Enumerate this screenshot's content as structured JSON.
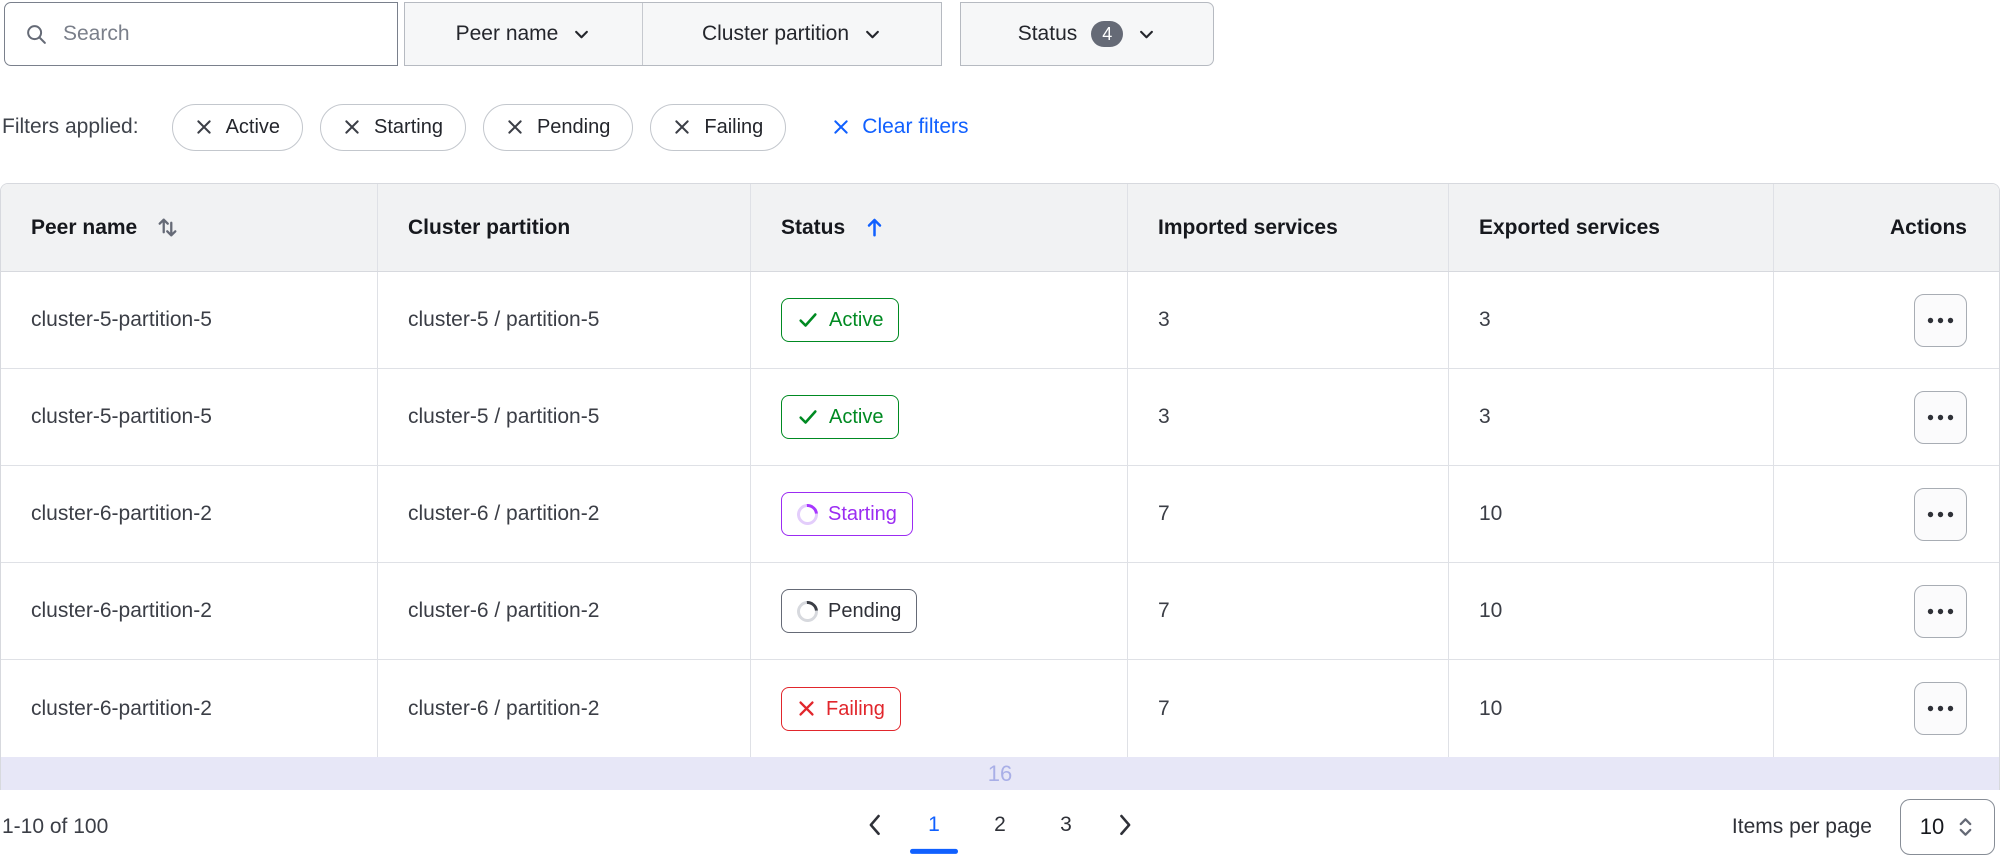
{
  "toolbar": {
    "search_placeholder": "Search",
    "dropdowns": [
      {
        "label": "Peer name"
      },
      {
        "label": "Cluster partition"
      },
      {
        "label": "Status",
        "count": "4"
      }
    ]
  },
  "filters_applied": {
    "label": "Filters applied:",
    "pills": [
      "Active",
      "Starting",
      "Pending",
      "Failing"
    ],
    "clear_label": "Clear filters"
  },
  "table": {
    "columns": [
      {
        "label": "Peer name",
        "sort": "both"
      },
      {
        "label": "Cluster partition",
        "sort": "none"
      },
      {
        "label": "Status",
        "sort": "asc"
      },
      {
        "label": "Imported services",
        "sort": "none"
      },
      {
        "label": "Exported services",
        "sort": "none"
      },
      {
        "label": "Actions",
        "sort": "none"
      }
    ],
    "rows": [
      {
        "peer_name": "cluster-5-partition-5",
        "cluster_partition": "cluster-5 / partition-5",
        "status": "Active",
        "imported": "3",
        "exported": "3"
      },
      {
        "peer_name": "cluster-5-partition-5",
        "cluster_partition": "cluster-5 / partition-5",
        "status": "Active",
        "imported": "3",
        "exported": "3"
      },
      {
        "peer_name": "cluster-6-partition-2",
        "cluster_partition": "cluster-6 / partition-2",
        "status": "Starting",
        "imported": "7",
        "exported": "10"
      },
      {
        "peer_name": "cluster-6-partition-2",
        "cluster_partition": "cluster-6 / partition-2",
        "status": "Pending",
        "imported": "7",
        "exported": "10"
      },
      {
        "peer_name": "cluster-6-partition-2",
        "cluster_partition": "cluster-6 / partition-2",
        "status": "Failing",
        "imported": "7",
        "exported": "10"
      }
    ],
    "partial_row_text": "16"
  },
  "pagination": {
    "range_text": "1-10 of 100",
    "pages": [
      "1",
      "2",
      "3"
    ],
    "current_page": "1",
    "items_per_page_label": "Items per page",
    "items_per_page_value": "10"
  },
  "colors": {
    "accent_blue": "#1060FF",
    "status_active_green": "#008A22",
    "status_starting_purple": "#9B2CF2",
    "status_pending_gray": "#656A76",
    "status_failing_red": "#E1262C",
    "count_badge_bg": "#656A76",
    "partial_row_bg": "#E7E7F7",
    "partial_row_text_color": "#A9AFE7"
  }
}
